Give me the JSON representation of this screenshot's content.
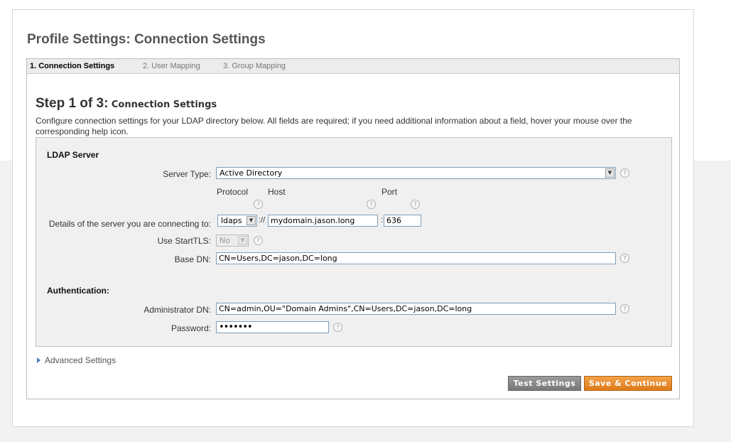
{
  "page_title": "Profile Settings: Connection Settings",
  "tabs": [
    {
      "label": "1. Connection Settings",
      "active": true
    },
    {
      "label": "2. User Mapping",
      "active": false
    },
    {
      "label": "3. Group Mapping",
      "active": false
    }
  ],
  "step": {
    "prefix": "Step 1 of 3:",
    "title": "Connection Settings",
    "intro": "Configure connection settings for your LDAP directory below. All fields are required; if you need additional information about a field, hover your mouse over the corresponding help icon."
  },
  "ldap_server": {
    "section_title": "LDAP Server",
    "server_type_label": "Server Type:",
    "server_type_value": "Active Directory",
    "protocol_label": "Protocol",
    "host_label": "Host",
    "port_label": "Port",
    "details_label": "Details of the server you are connecting to:",
    "protocol_value": "ldaps",
    "protocol_sep": "://",
    "port_sep": ":",
    "host_value": "mydomain.jason.long",
    "port_value": "636",
    "starttls_label": "Use StartTLS:",
    "starttls_value": "No",
    "base_dn_label": "Base DN:",
    "base_dn_value": "CN=Users,DC=jason,DC=long"
  },
  "authentication": {
    "section_title": "Authentication:",
    "admin_dn_label": "Administrator DN:",
    "admin_dn_value": "CN=admin,OU=\"Domain Admins\",CN=Users,DC=jason,DC=long",
    "password_label": "Password:",
    "password_value": "•••••••"
  },
  "advanced_settings_label": "Advanced Settings",
  "help_glyph": "?",
  "buttons": {
    "test": "Test Settings",
    "save": "Save & Continue"
  }
}
